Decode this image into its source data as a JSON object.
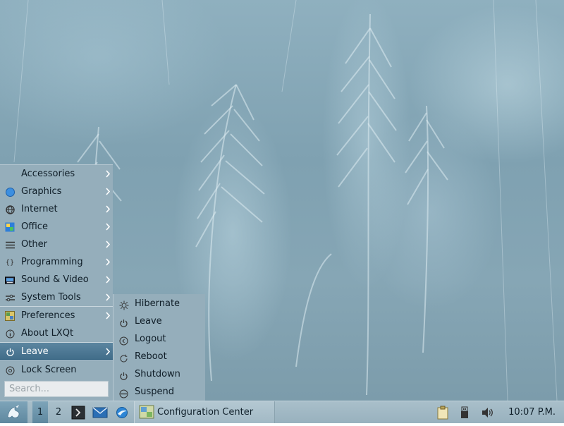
{
  "main_menu": {
    "items": [
      {
        "label": "Accessories",
        "icon": "accessories-icon",
        "submenu": true
      },
      {
        "label": "Graphics",
        "icon": "graphics-icon",
        "submenu": true
      },
      {
        "label": "Internet",
        "icon": "internet-icon",
        "submenu": true
      },
      {
        "label": "Office",
        "icon": "office-icon",
        "submenu": true
      },
      {
        "label": "Other",
        "icon": "other-icon",
        "submenu": true
      },
      {
        "label": "Programming",
        "icon": "programming-icon",
        "submenu": true
      },
      {
        "label": "Sound & Video",
        "icon": "sound-video-icon",
        "submenu": true
      },
      {
        "label": "System Tools",
        "icon": "system-tools-icon",
        "submenu": true
      },
      {
        "label": "Preferences",
        "icon": "preferences-icon",
        "submenu": true
      },
      {
        "label": "About LXQt",
        "icon": "about-icon",
        "submenu": false
      },
      {
        "label": "Leave",
        "icon": "power-icon",
        "submenu": true,
        "active": true
      },
      {
        "label": "Lock Screen",
        "icon": "lock-screen-icon",
        "submenu": false
      }
    ],
    "search_placeholder": "Search..."
  },
  "leave_menu": {
    "items": [
      {
        "label": "Hibernate",
        "icon": "hibernate-icon"
      },
      {
        "label": "Leave",
        "icon": "power-icon"
      },
      {
        "label": "Logout",
        "icon": "logout-icon"
      },
      {
        "label": "Reboot",
        "icon": "reboot-icon"
      },
      {
        "label": "Shutdown",
        "icon": "shutdown-icon"
      },
      {
        "label": "Suspend",
        "icon": "suspend-icon"
      }
    ]
  },
  "taskbar": {
    "desktops": [
      "1",
      "2"
    ],
    "current_desktop": "1",
    "quicklaunch": [
      "terminal-icon",
      "mail-icon",
      "browser-icon"
    ],
    "task": {
      "label": "Configuration Center",
      "icon": "configuration-center-icon"
    },
    "tray": [
      "clipboard-icon",
      "removable-media-icon",
      "volume-icon"
    ],
    "clock": "10:07 P.M."
  },
  "colors": {
    "menu_bg": "#95aebb",
    "menu_highlight": "#4a7692",
    "taskbar_bg": "#a3bac6"
  }
}
